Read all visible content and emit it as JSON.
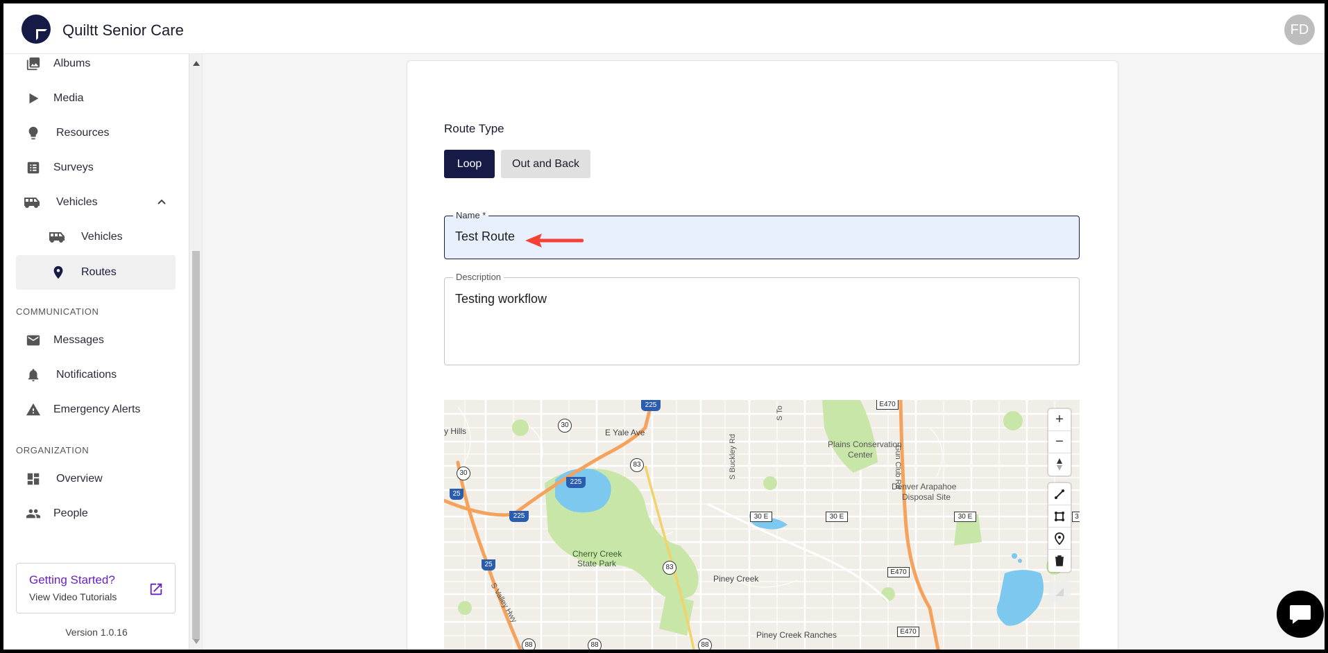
{
  "app": {
    "title": "Quiltt Senior Care",
    "avatar_initials": "FD"
  },
  "sidebar": {
    "items": [
      {
        "label": "Albums",
        "icon": "photo-library-icon"
      },
      {
        "label": "Media",
        "icon": "play-icon"
      },
      {
        "label": "Resources",
        "icon": "lightbulb-icon"
      },
      {
        "label": "Surveys",
        "icon": "survey-icon"
      },
      {
        "label": "Vehicles",
        "icon": "bus-icon",
        "expanded": true
      },
      {
        "label": "Vehicles",
        "icon": "bus-icon",
        "sub": true
      },
      {
        "label": "Routes",
        "icon": "location-pin-icon",
        "sub": true,
        "active": true
      }
    ],
    "sections": {
      "communication": {
        "label": "COMMUNICATION",
        "items": [
          {
            "label": "Messages",
            "icon": "mail-icon"
          },
          {
            "label": "Notifications",
            "icon": "bell-icon"
          },
          {
            "label": "Emergency Alerts",
            "icon": "warning-icon"
          }
        ]
      },
      "organization": {
        "label": "ORGANIZATION",
        "items": [
          {
            "label": "Overview",
            "icon": "dashboard-icon"
          },
          {
            "label": "People",
            "icon": "people-icon"
          }
        ]
      }
    },
    "getting_started": {
      "title": "Getting Started?",
      "subtitle": "View Video Tutorials"
    },
    "version": "Version 1.0.16"
  },
  "form": {
    "route_type_label": "Route Type",
    "route_types": [
      "Loop",
      "Out and Back"
    ],
    "selected_route_type": "Loop",
    "name": {
      "label": "Name *",
      "value": "Test Route"
    },
    "description": {
      "label": "Description",
      "value": "Testing workflow"
    }
  },
  "map": {
    "labels": {
      "yale": "E Yale Ave",
      "hills": "y Hills",
      "buckley": "S Buckley Rd",
      "gunclub": "Gun Club Rd",
      "plains": "Plains Conservation",
      "plains2": "Center",
      "denver": "Denver Arapahoe",
      "denver2": "Disposal Site",
      "cherry": "Cherry Creek",
      "cherry2": "State Park",
      "piney": "Piney Creek",
      "pineyranches": "Piney Creek Ranches",
      "valley": "S Valley Hwy",
      "s_to": "S To"
    },
    "shields": {
      "i225a": "225",
      "i225b": "225",
      "i225c": "225",
      "i25a": "25",
      "i25b": "25",
      "r30a": "30",
      "r30b": "30",
      "r83a": "83",
      "r83b": "83",
      "r88a": "88",
      "r88b": "88",
      "r88c": "88",
      "e470a": "E470",
      "e470b": "E470",
      "e470c": "E470",
      "e30a": "30 E",
      "e30b": "30 E",
      "e30c": "30 E",
      "e30d": "3"
    },
    "controls": {
      "zoom_in": "+",
      "zoom_out": "−"
    }
  },
  "colors": {
    "brand": "#161a46",
    "accent": "#6a1fc2",
    "arrow": "#f44336"
  }
}
